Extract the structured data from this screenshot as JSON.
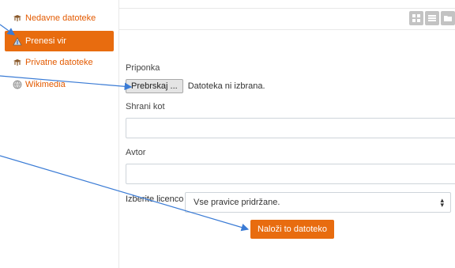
{
  "sidebar": {
    "items": [
      {
        "label": "Nedavne datoteke",
        "icon": "moodle-hat-icon"
      },
      {
        "label": "Prenesi vir",
        "icon": "upload-icon",
        "active": true
      },
      {
        "label": "Privatne datoteke",
        "icon": "moodle-hat-icon"
      },
      {
        "label": "Wikimedia",
        "icon": "globe-icon"
      }
    ]
  },
  "toolbar": {
    "view_icons": [
      "grid-view-icon",
      "list-view-icon",
      "folder-view-icon"
    ]
  },
  "form": {
    "attachment_label": "Priponka",
    "browse_button": "Prebrskaj ...",
    "file_status": "Datoteka ni izbrana.",
    "save_as_label": "Shrani kot",
    "save_as_value": "",
    "author_label": "Avtor",
    "author_value": "",
    "license_label": "Izberite licenco",
    "license_selected": "Vse pravice pridržane.",
    "submit_label": "Naloži to datoteko"
  },
  "colors": {
    "accent": "#e86c0f",
    "link": "#e35a00",
    "arrow": "#3a7bd5"
  }
}
